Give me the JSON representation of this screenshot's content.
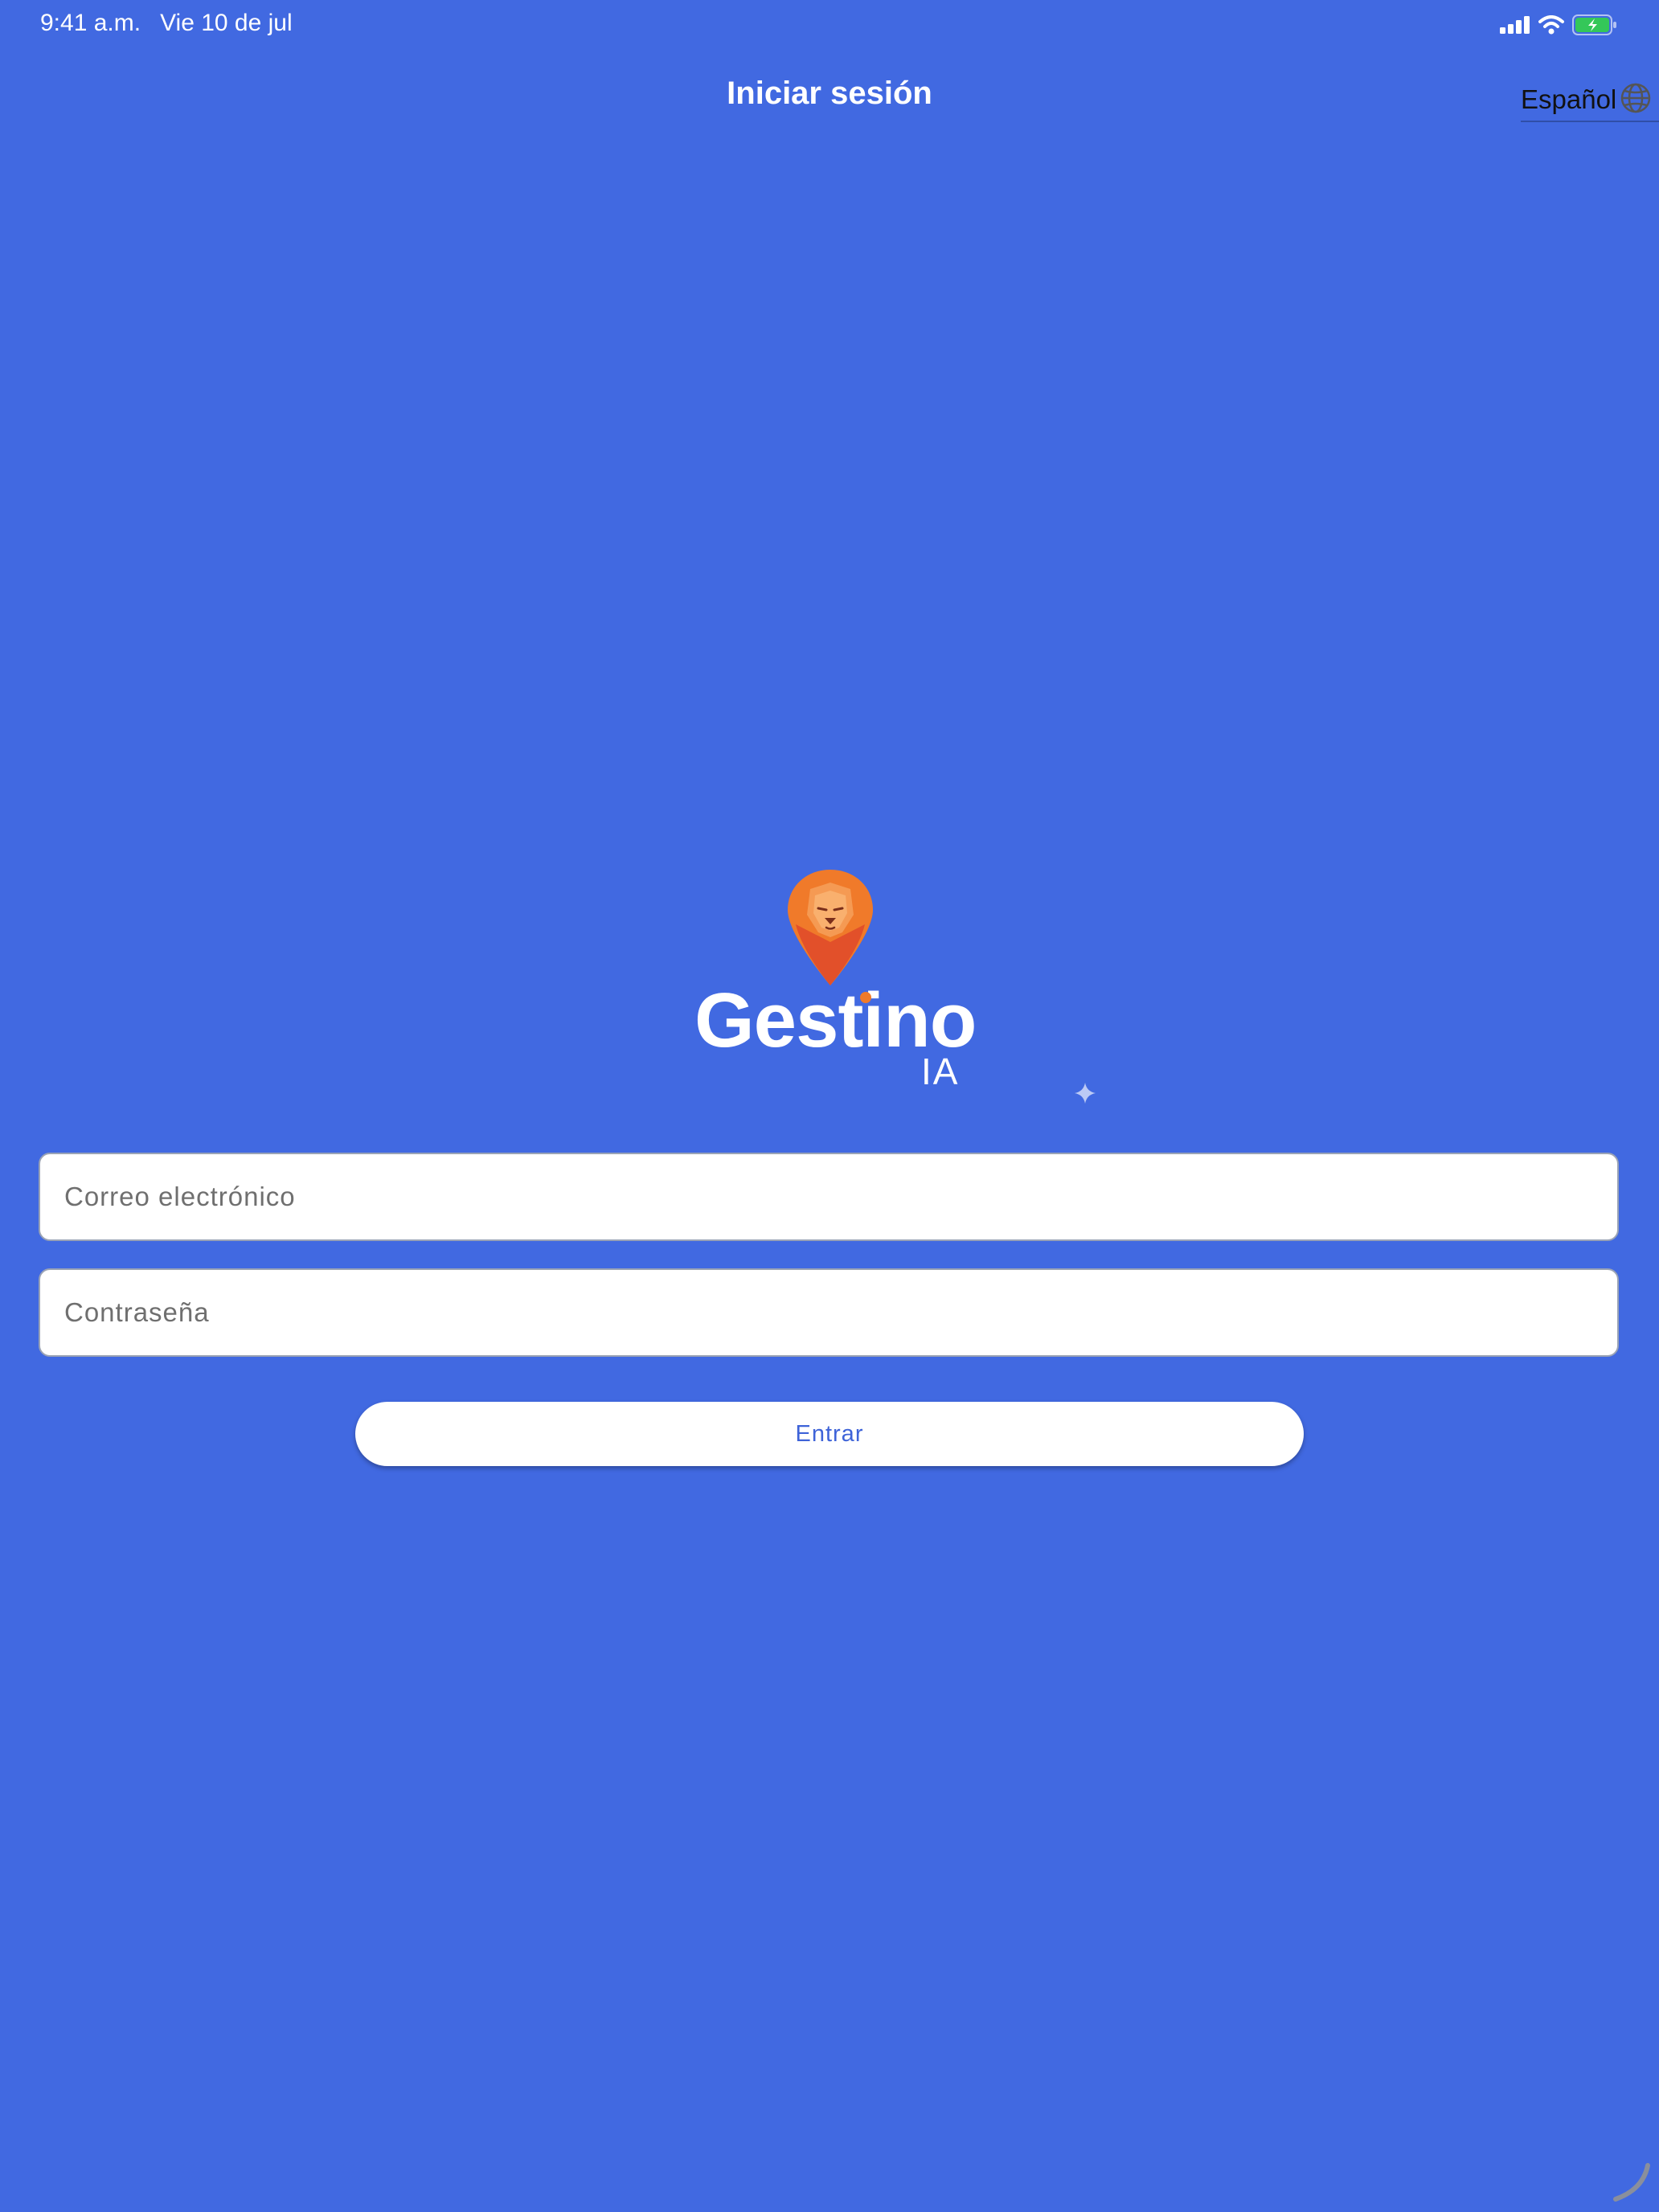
{
  "status_bar": {
    "time": "9:41 a.m.",
    "date": "Vie 10 de jul"
  },
  "header": {
    "title": "Iniciar sesión",
    "language": "Español"
  },
  "logo": {
    "name": "Gestino",
    "suffix": "IA"
  },
  "form": {
    "email_placeholder": "Correo electrónico",
    "password_placeholder": "Contraseña",
    "submit_label": "Entrar"
  },
  "colors": {
    "background": "#4169E1",
    "accent_orange": "#F07A2A",
    "battery_green": "#34C759",
    "button_text": "#3E63D8"
  },
  "icons": {
    "signal": "cellular-signal-icon",
    "wifi": "wifi-icon",
    "battery": "battery-charging-icon",
    "language": "globe-icon",
    "logo": "lion-pin-icon",
    "sparkle": "sparkle-icon"
  }
}
